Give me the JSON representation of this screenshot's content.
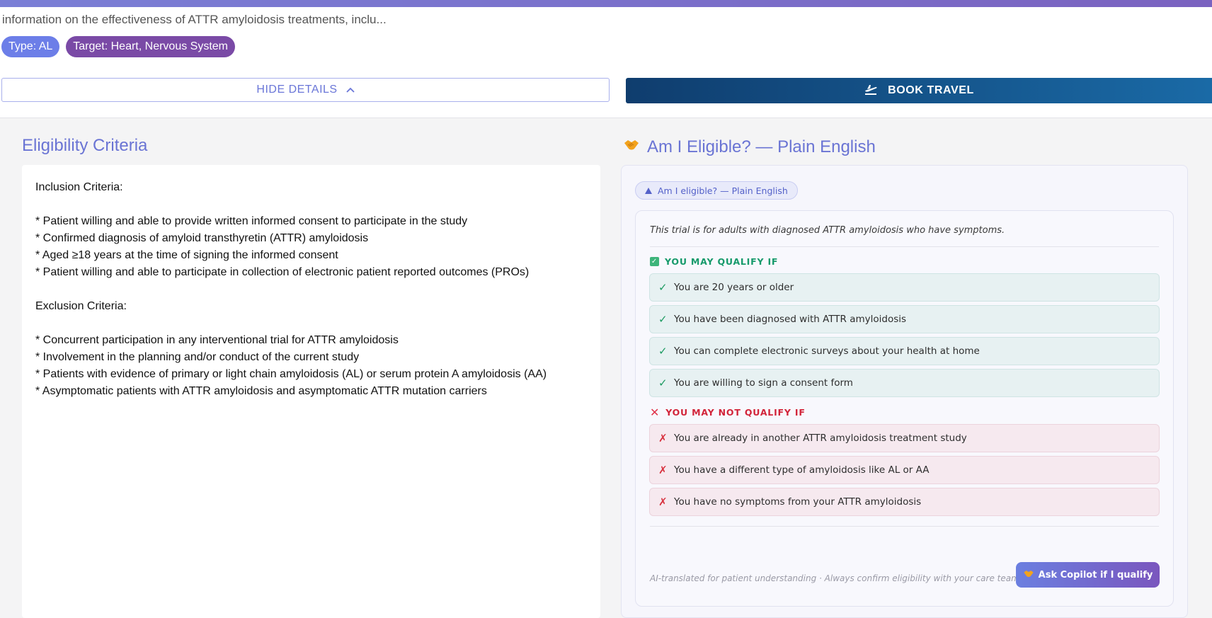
{
  "header": {
    "description": "information on the effectiveness of ATTR amyloidosis treatments, inclu...",
    "tags": [
      "Type: AL",
      "Target: Heart, Nervous System"
    ],
    "hide_details_label": "HIDE DETAILS",
    "book_travel_label": "BOOK TRAVEL"
  },
  "eligibility": {
    "title": "Eligibility Criteria",
    "text": "Inclusion Criteria:\n\n* Patient willing and able to provide written informed consent to participate in the study\n* Confirmed diagnosis of amyloid transthyretin (ATTR) amyloidosis\n* Aged ≥18 years at the time of signing the informed consent\n* Patient willing and able to participate in collection of electronic patient reported outcomes (PROs)\n\nExclusion Criteria:\n\n* Concurrent participation in any interventional trial for ATTR amyloidosis\n* Involvement in the planning and/or conduct of the current study\n* Patients with evidence of primary or light chain amyloidosis (AL) or serum protein A amyloidosis (AA)\n* Asymptomatic patients with ATTR amyloidosis and asymptomatic ATTR mutation carriers"
  },
  "plain_english": {
    "title": "Am I Eligible? — Plain English",
    "toggle_label": "Am I eligible? — Plain English",
    "intro": "This trial is for adults with diagnosed ATTR amyloidosis who have symptoms.",
    "qualify_label": "YOU MAY QUALIFY IF",
    "qualify_items": [
      "You are 20 years or older",
      "You have been diagnosed with ATTR amyloidosis",
      "You can complete electronic surveys about your health at home",
      "You are willing to sign a consent form"
    ],
    "not_qualify_label": "YOU MAY NOT QUALIFY IF",
    "not_qualify_items": [
      "You are already in another ATTR amyloidosis treatment study",
      "You have a different type of amyloidosis like AL or AA",
      "You have no symptoms from your ATTR amyloidosis"
    ],
    "footer_note": "AI-translated for patient understanding · Always confirm eligibility with your care team",
    "copilot_label": "Ask Copilot if I qualify"
  },
  "colors": {
    "accent": "#6a74d4",
    "book_travel": "#0f3d6e",
    "qualify": "#169a6b",
    "not_qualify": "#d2243a"
  },
  "icons": [
    "chevron-up-icon",
    "airplane-takeoff-icon",
    "handshake-icon",
    "triangle-up-icon",
    "checkbox-icon",
    "cross-icon",
    "check-icon"
  ]
}
